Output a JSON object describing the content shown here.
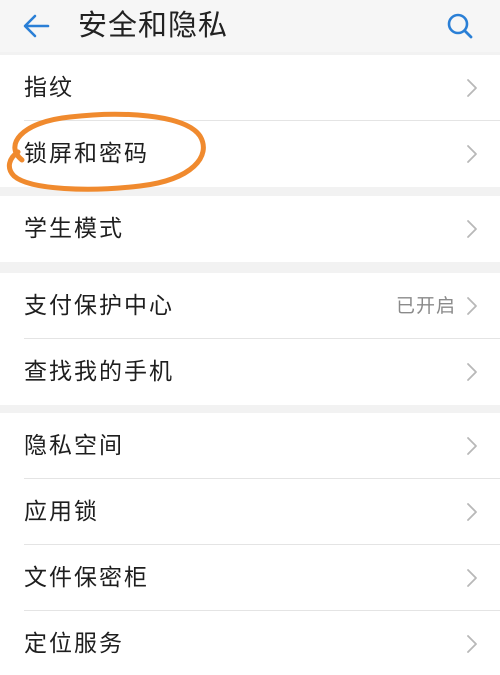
{
  "header": {
    "title": "安全和隐私",
    "back_icon": "arrow-left-icon",
    "search_icon": "search-icon",
    "accent_color": "#2a7fd6"
  },
  "groups": [
    {
      "items": [
        {
          "label": "指纹",
          "value": ""
        },
        {
          "label": "锁屏和密码",
          "value": ""
        }
      ]
    },
    {
      "items": [
        {
          "label": "学生模式",
          "value": ""
        }
      ]
    },
    {
      "items": [
        {
          "label": "支付保护中心",
          "value": "已开启"
        },
        {
          "label": "查找我的手机",
          "value": ""
        }
      ]
    },
    {
      "items": [
        {
          "label": "隐私空间",
          "value": ""
        },
        {
          "label": "应用锁",
          "value": ""
        },
        {
          "label": "文件保密柜",
          "value": ""
        },
        {
          "label": "定位服务",
          "value": ""
        }
      ]
    }
  ],
  "annotation": {
    "shape": "hand-drawn-ellipse",
    "color": "#f08a2e",
    "target": "锁屏和密码"
  }
}
